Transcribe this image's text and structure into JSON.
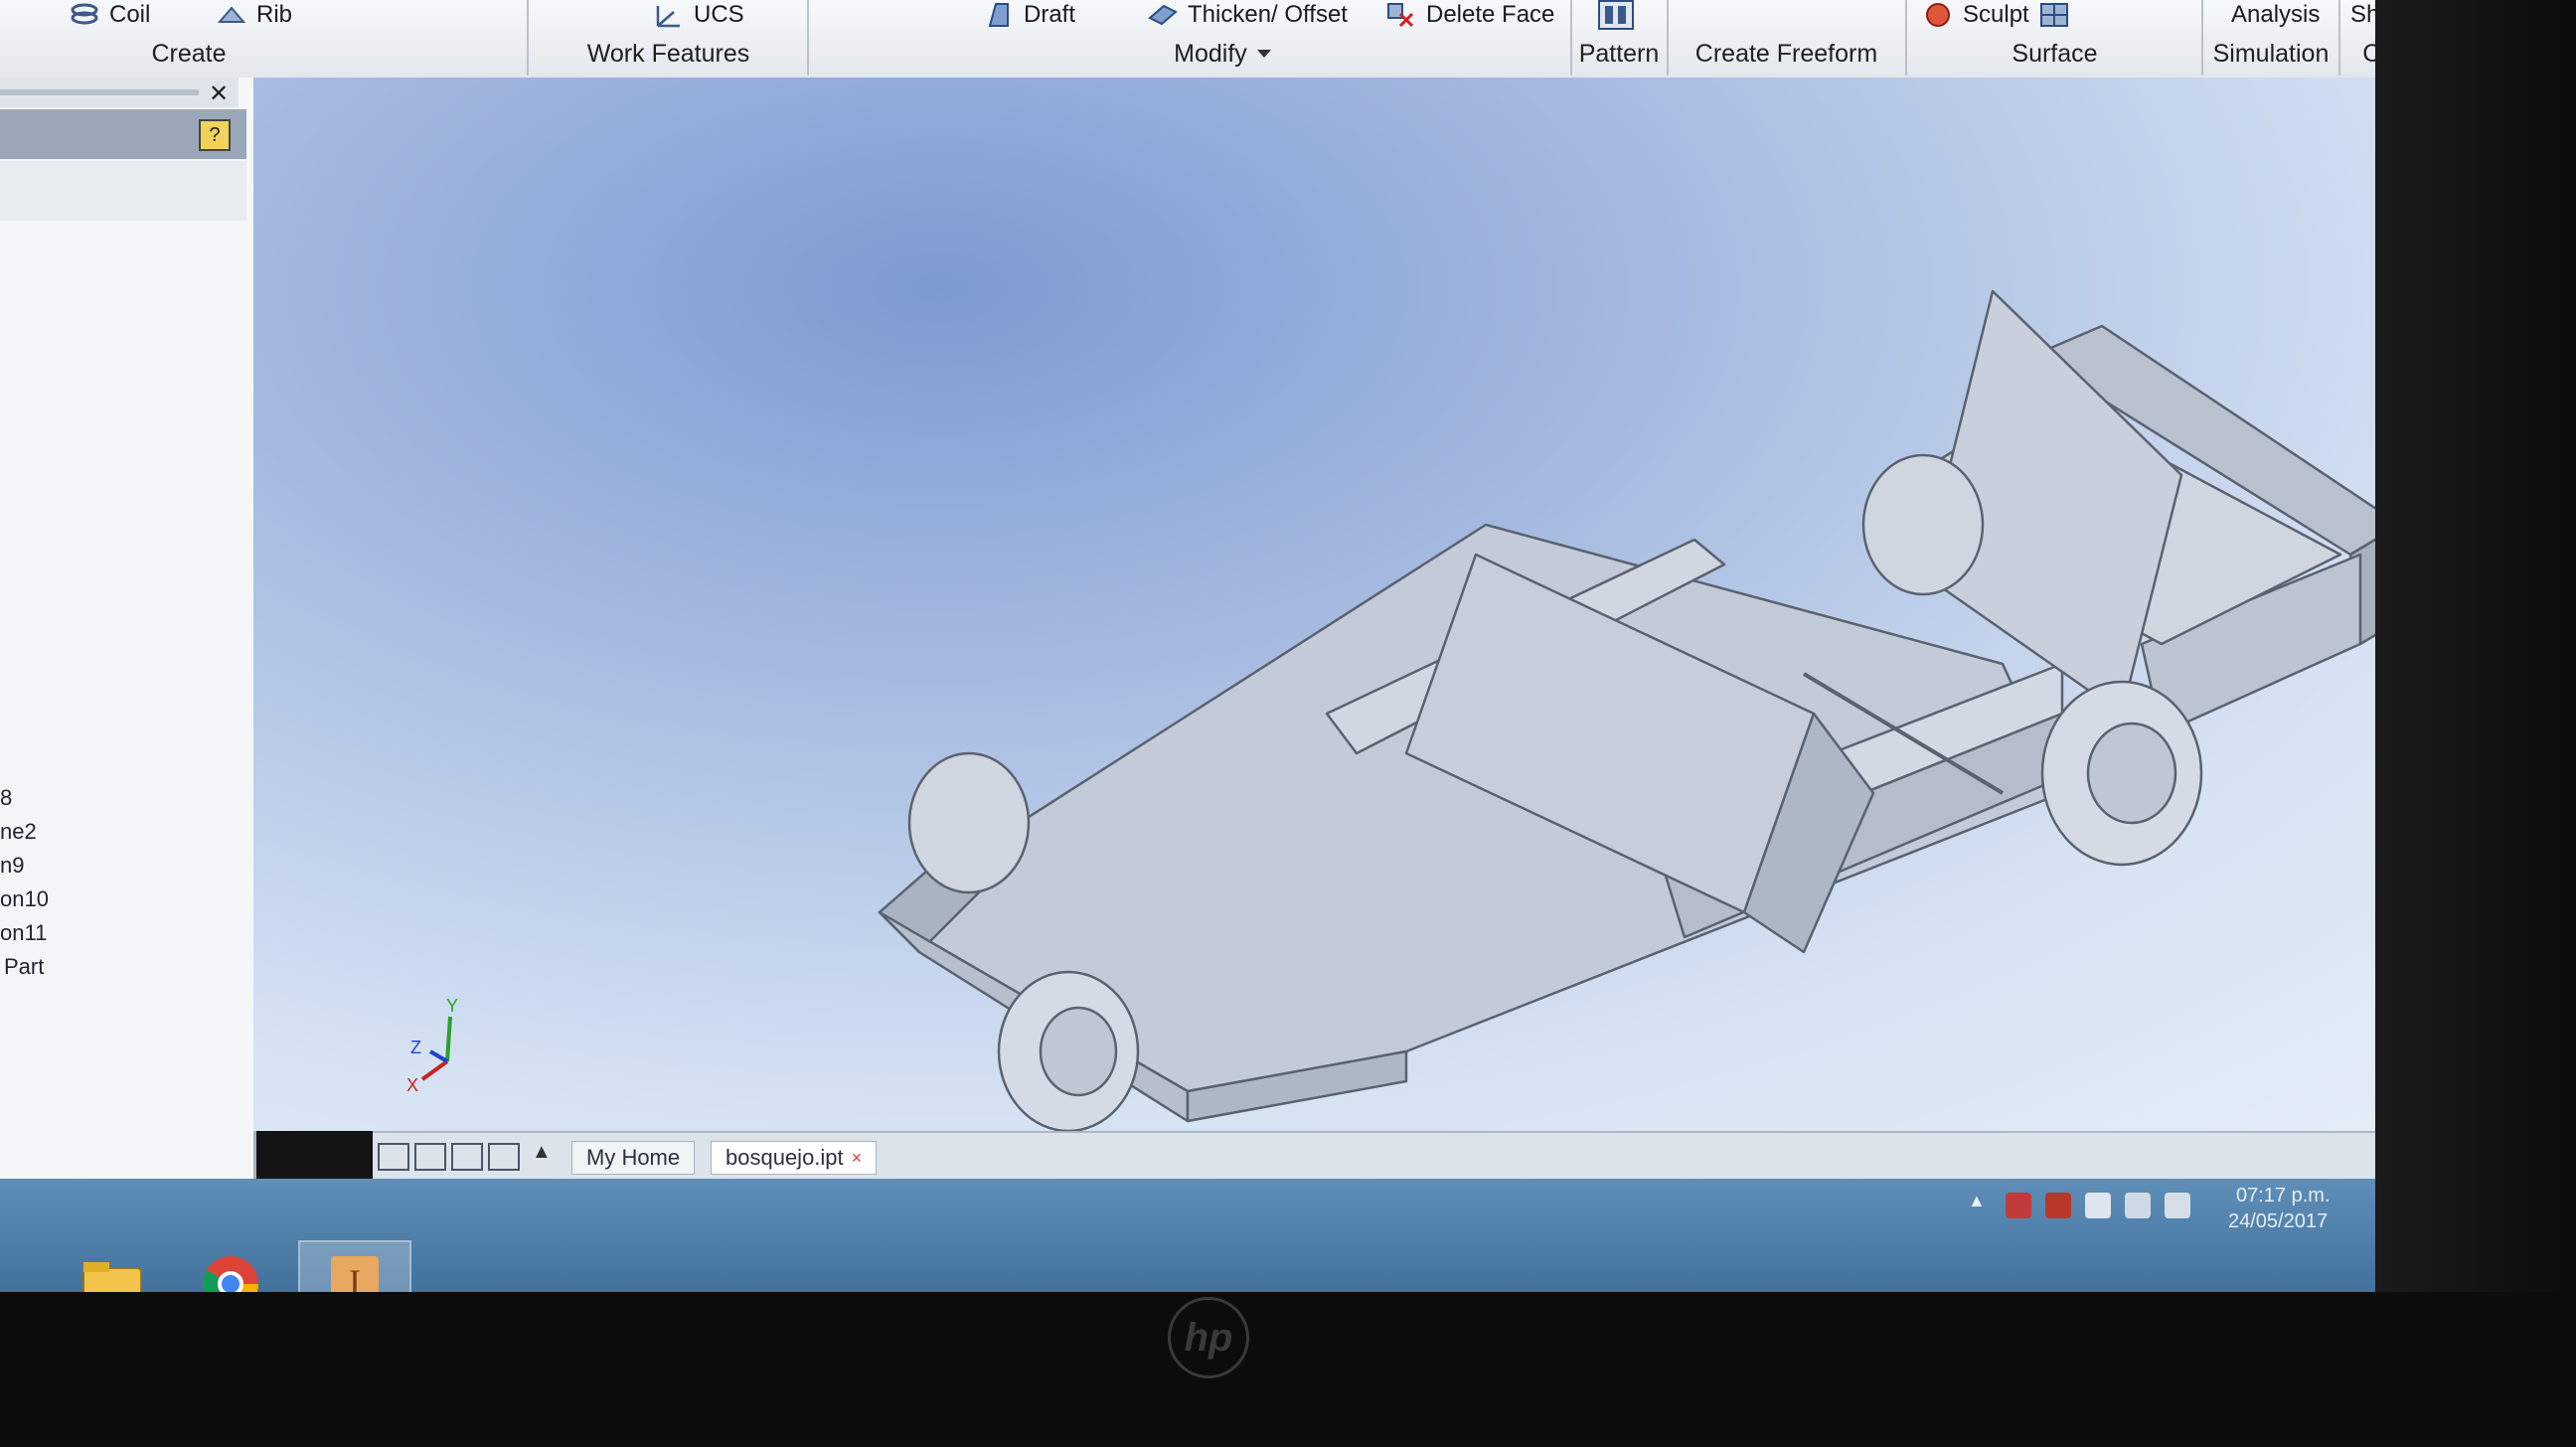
{
  "ribbon": {
    "buttons": {
      "coil": "Coil",
      "rib": "Rib",
      "ucs": "UCS",
      "draft": "Draft",
      "thicken_offset": "Thicken/ Offset",
      "delete_face": "Delete Face",
      "sculpt": "Sculpt",
      "analysis": "Analysis",
      "sheet_metal": "Sheet Metal"
    },
    "panels": {
      "create": "Create",
      "work_features": "Work Features",
      "modify": "Modify",
      "pattern": "Pattern",
      "create_freeform": "Create Freeform",
      "surface": "Surface",
      "simulation": "Simulation",
      "convert": "Convert"
    }
  },
  "browser": {
    "items": [
      "8",
      "ne2",
      "n9",
      "on10",
      "on11",
      "Part"
    ]
  },
  "tabs": {
    "home": "My Home",
    "document": "bosquejo.ipt"
  },
  "tray": {
    "time": "07:17 p.m.",
    "date": "24/05/2017"
  },
  "axes": {
    "x": "X",
    "y": "Y",
    "z": "Z"
  },
  "colors": {
    "ribbon_bg": "#eceff3",
    "viewport_top": "#7d9ad0",
    "viewport_bottom": "#e6eef8",
    "model_face": "#c8d0dc",
    "taskbar": "#4a7aa6"
  },
  "icons": {
    "viewcube": "viewcube-icon",
    "navbar": [
      "steering-wheel-icon",
      "pan-icon",
      "zoom-icon",
      "orbit-icon",
      "look-at-icon"
    ],
    "taskbar": [
      "file-explorer-icon",
      "chrome-icon",
      "inventor-icon"
    ],
    "window_controls": [
      "minimize-icon",
      "restore-icon",
      "close-icon"
    ]
  }
}
